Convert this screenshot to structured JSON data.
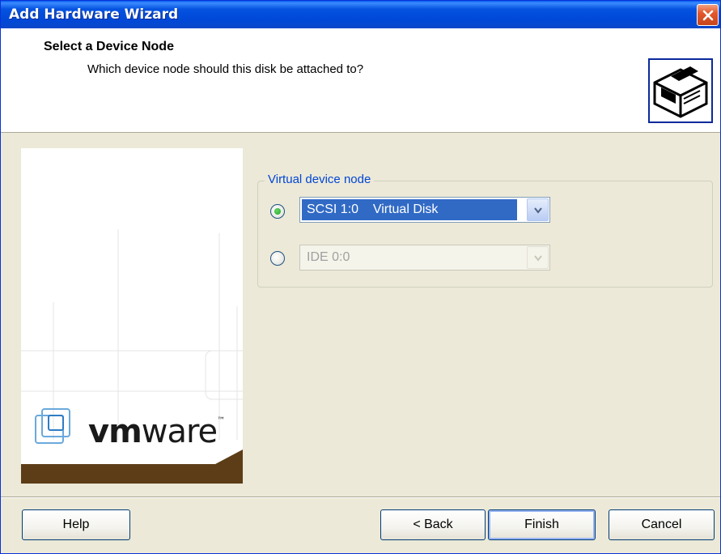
{
  "window": {
    "title": "Add Hardware Wizard"
  },
  "header": {
    "title": "Select a Device Node",
    "subtitle": "Which device node should this disk be attached to?",
    "icon": "hardware-drive-icon"
  },
  "branding": {
    "logo": "vmware",
    "logo_text_bold": "vm",
    "logo_text_rest": "ware",
    "trademark": "™"
  },
  "device_node": {
    "group_label": "Virtual device node",
    "options": [
      {
        "selected": true,
        "enabled": true,
        "value": "SCSI 1:0    Virtual Disk"
      },
      {
        "selected": false,
        "enabled": false,
        "value": "IDE 0:0"
      }
    ]
  },
  "buttons": {
    "help": "Help",
    "back": "< Back",
    "finish": "Finish",
    "cancel": "Cancel"
  },
  "colors": {
    "titlebar": "#0a5ef0",
    "selection": "#316ac5",
    "group_label": "#0046d5",
    "brand_brown": "#5c3d17"
  }
}
